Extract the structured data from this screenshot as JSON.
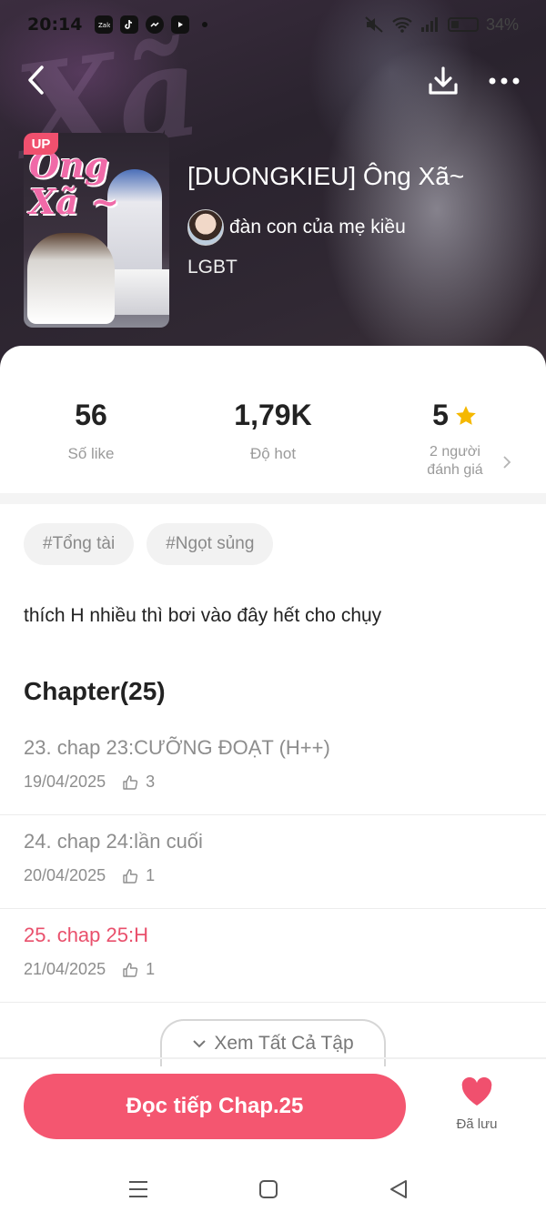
{
  "status_bar": {
    "time": "20:14",
    "battery": "34%",
    "apps": [
      "zalo-icon",
      "tiktok-icon",
      "messenger-icon",
      "youtube-icon"
    ]
  },
  "header": {
    "back_icon": "chevron-left-icon",
    "download_icon": "download-icon",
    "more_icon": "more-dots-icon"
  },
  "story": {
    "badge": "UP",
    "cover_text": "Ông\nXã ~",
    "title": "[DUONGKIEU] Ông Xã~",
    "author": "đàn con của mẹ kiều",
    "genre": "LGBT"
  },
  "stats": {
    "likes": {
      "value": "56",
      "label": "Số like"
    },
    "hot": {
      "value": "1,79K",
      "label": "Độ hot"
    },
    "rating": {
      "value": "5",
      "label_line1": "2 người",
      "label_line2": "đánh giá"
    }
  },
  "tags": [
    "#Tổng tài",
    "#Ngọt sủng"
  ],
  "description": "thích H nhiều thì bơi vào đây hết cho chụy",
  "chapters": {
    "heading": "Chapter(25)",
    "items": [
      {
        "title": "23. chap 23:CƯỠNG ĐOẠT (H++)",
        "date": "19/04/2025",
        "likes": "3",
        "current": false
      },
      {
        "title": "24. chap 24:lần cuối",
        "date": "20/04/2025",
        "likes": "1",
        "current": false
      },
      {
        "title": "25. chap 25:H",
        "date": "21/04/2025",
        "likes": "1",
        "current": true
      }
    ],
    "see_all": "Xem Tất Cả Tập"
  },
  "actions": {
    "continue_reading": "Đọc tiếp Chap.25",
    "save_label": "Đã lưu"
  },
  "colors": {
    "accent": "#f45670",
    "current_chapter": "#e9506c",
    "star": "#f5b800"
  }
}
